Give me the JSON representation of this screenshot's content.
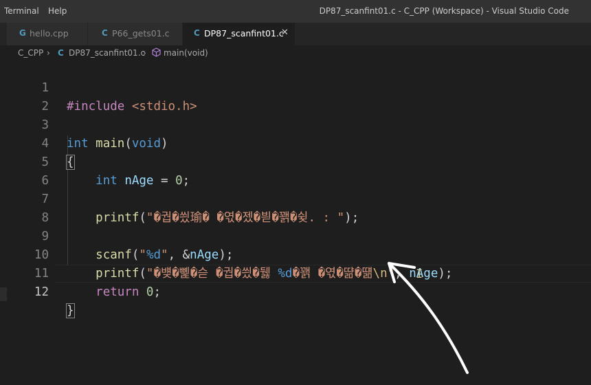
{
  "menu": {
    "items": [
      "Terminal",
      "Help"
    ]
  },
  "window_title": "DP87_scanfint01.c - C_CPP (Workspace) - Visual Studio Code",
  "tabs": [
    {
      "icon": "G",
      "label": "hello.cpp"
    },
    {
      "icon": "C",
      "label": "P66_gets01.c"
    },
    {
      "icon": "C",
      "label": "DP87_scanfint01.c",
      "close": "✕"
    }
  ],
  "breadcrumb": {
    "folder": "C_CPP",
    "sep": "›",
    "file_icon": "C",
    "file": "DP87_scanfint01.c",
    "symbol": "main(void)"
  },
  "line_numbers": [
    "1",
    "2",
    "3",
    "4",
    "5",
    "6",
    "7",
    "8",
    "9",
    "10",
    "11",
    "12"
  ],
  "code": {
    "l1": {
      "directive": "#include",
      "header": "<stdio.h>"
    },
    "l3": {
      "type": "int",
      "fn": "main",
      "paren_open": "(",
      "param": "void",
      "paren_close": ")"
    },
    "l4": {
      "brace": "{"
    },
    "l5": {
      "type": "int",
      "var": "nAge",
      "op": " = ",
      "num": "0",
      "end": ";"
    },
    "l7": {
      "fn": "printf",
      "open": "(",
      "str": "\"�궙�씠瑜� �엯�젰�븯�꽭�슂. : \"",
      "close": ");"
    },
    "l9": {
      "fn": "scanf",
      "open": "(",
      "str1": "\"",
      "fmt": "%d",
      "str2": "\"",
      "mid": ", &",
      "var": "nAge",
      "close": ");"
    },
    "l10": {
      "fn": "printf",
      "open": "(",
      "str1": "\"�뱾�뼱�슫 �궙�씠�뒗 ",
      "fmt": "%d",
      "str2": "�꽭 �엯�땲�떎",
      "esc": "\\n",
      "str3": "\"",
      "mid": ", ",
      "var": "nAge",
      "close": ");"
    },
    "l11": {
      "kw": "return",
      "num": "0",
      "end": ";"
    },
    "l12": {
      "brace": "}"
    }
  },
  "colors": {
    "keyword": "#569cd6",
    "string": "#ce9178",
    "function": "#dcdcaa",
    "variable": "#9cdcfe",
    "number": "#b5cea8"
  },
  "cursor_icon": "text-ibeam-cursor",
  "annotation": "hand-drawn-white-arrow"
}
